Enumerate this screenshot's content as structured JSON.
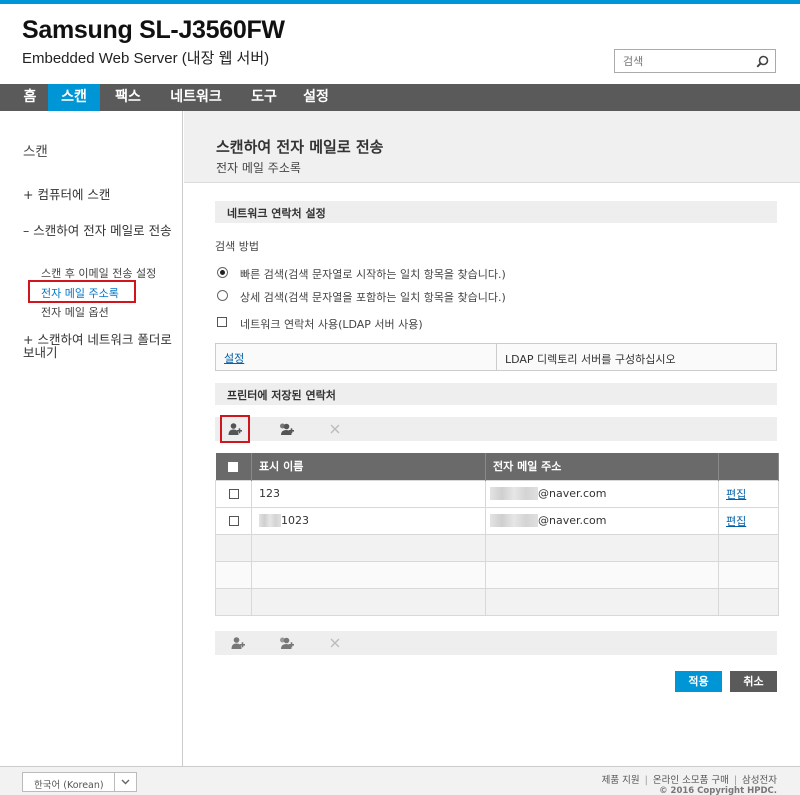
{
  "header": {
    "brand": "Samsung SL-J3560FW",
    "subtitle": "Embedded Web Server (내장 웹 서버)",
    "search_placeholder": "검색"
  },
  "nav": {
    "tabs": [
      {
        "label": "홈"
      },
      {
        "label": "스캔",
        "active": true
      },
      {
        "label": "팩스"
      },
      {
        "label": "네트워크"
      },
      {
        "label": "도구"
      },
      {
        "label": "설정"
      }
    ]
  },
  "sidebar": {
    "heading": "스캔",
    "items": [
      {
        "label": "+ 컴퓨터에 스캔"
      },
      {
        "label": "– 스캔하여 전자 메일로 전송"
      },
      {
        "label": "스캔 후 이메일 전송 설정"
      },
      {
        "label": "전자 메일 주소록",
        "selected": true
      },
      {
        "label": "전자 메일 옵션"
      },
      {
        "label": "+ 스캔하여 네트워크 폴더로 보내기"
      }
    ]
  },
  "page": {
    "title": "스캔하여 전자 메일로 전송",
    "subtitle": "전자 메일 주소록"
  },
  "network_contacts": {
    "section_title": "네트워크 연락처 설정",
    "search_method_label": "검색 방법",
    "option_quick": "빠른 검색(검색 문자열로 시작하는 일치 항목을 찾습니다.)",
    "option_detail": "상세 검색(검색 문자열을 포함하는 일치 항목을 찾습니다.)",
    "ldap_checkbox": "네트워크 연락처 사용(LDAP 서버 사용)",
    "settings_link": "설정",
    "ldap_note": "LDAP 디렉토리 서버를 구성하십시오"
  },
  "printer_contacts": {
    "section_title": "프린터에 저장된 연락처",
    "columns": [
      "표시 이름",
      "전자 메일 주소"
    ],
    "rows": [
      {
        "name": "123",
        "email": "@naver.com",
        "edit": "편집"
      },
      {
        "name": "1023",
        "email": "@naver.com",
        "edit": "편집"
      }
    ]
  },
  "actions": {
    "apply": "적용",
    "cancel": "취소"
  },
  "footer": {
    "language": "한국어 (Korean)",
    "links": [
      "제품 지원",
      "온라인 소모품 구매",
      "삼성전자"
    ],
    "copyright": "© 2016 Copyright HPDC."
  },
  "colors": {
    "accent": "#0096d6",
    "nav_bg": "#5a5a5a",
    "highlight_border": "#d0161c",
    "table_header": "#6a6a6a"
  }
}
